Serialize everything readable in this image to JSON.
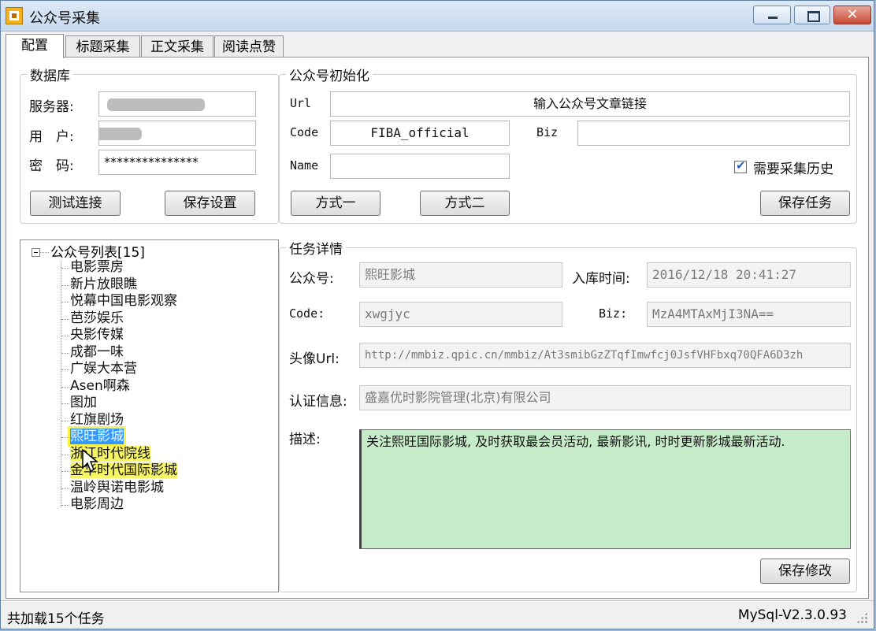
{
  "window": {
    "title": "公众号采集"
  },
  "tabs": [
    "配置",
    "标题采集",
    "正文采集",
    "阅读点赞"
  ],
  "database": {
    "legend": "数据库",
    "server_label": "服务器:",
    "server_value": "",
    "user_label": "用　户:",
    "user_value": "",
    "password_label": "密　码:",
    "password_value": "***************",
    "test_button": "测试连接",
    "save_button": "保存设置"
  },
  "init": {
    "legend": "公众号初始化",
    "url_label": "Url",
    "url_value": "输入公众号文章链接",
    "code_label": "Code",
    "code_value": "FIBA_official",
    "biz_label": "Biz",
    "biz_value": "",
    "name_label": "Name",
    "name_value": "",
    "history_label": "需要采集历史",
    "history_checked": true,
    "method1_button": "方式一",
    "method2_button": "方式二",
    "save_task_button": "保存任务"
  },
  "tree": {
    "root": "公众号列表[15]",
    "items": [
      "电影票房",
      "新片放眼瞧",
      "悦幕中国电影观察",
      "芭莎娱乐",
      "央影传媒",
      "成都一味",
      "广娱大本营",
      "Asen啊森",
      "图加",
      "红旗剧场",
      "熙旺影城",
      "浙江时代院线",
      "金华时代国际影城",
      "温岭舆诺电影城",
      "电影周边"
    ],
    "selected_index": 10
  },
  "details": {
    "legend": "任务详情",
    "account_label": "公众号:",
    "account_value": "熙旺影城",
    "time_label": "入库时间:",
    "time_value": "2016/12/18 20:41:27",
    "code_label": "Code:",
    "code_value": "xwgjyc",
    "biz_label": "Biz:",
    "biz_value": "MzA4MTAxMjI3NA==",
    "avatar_label": "头像Url:",
    "avatar_value": "http://mmbiz.qpic.cn/mmbiz/At3smibGzZTqfImwfcj0JsfVHFbxq70QFA6D3zh",
    "auth_label": "认证信息:",
    "auth_value": "盛嘉优时影院管理(北京)有限公司",
    "desc_label": "描述:",
    "desc_value": "关注熙旺国际影城, 及时获取最会员活动, 最新影讯, 时时更新影城最新活动.",
    "save_button": "保存修改"
  },
  "status": {
    "left": "共加载15个任务",
    "right": "MySql-V2.3.0.93"
  }
}
